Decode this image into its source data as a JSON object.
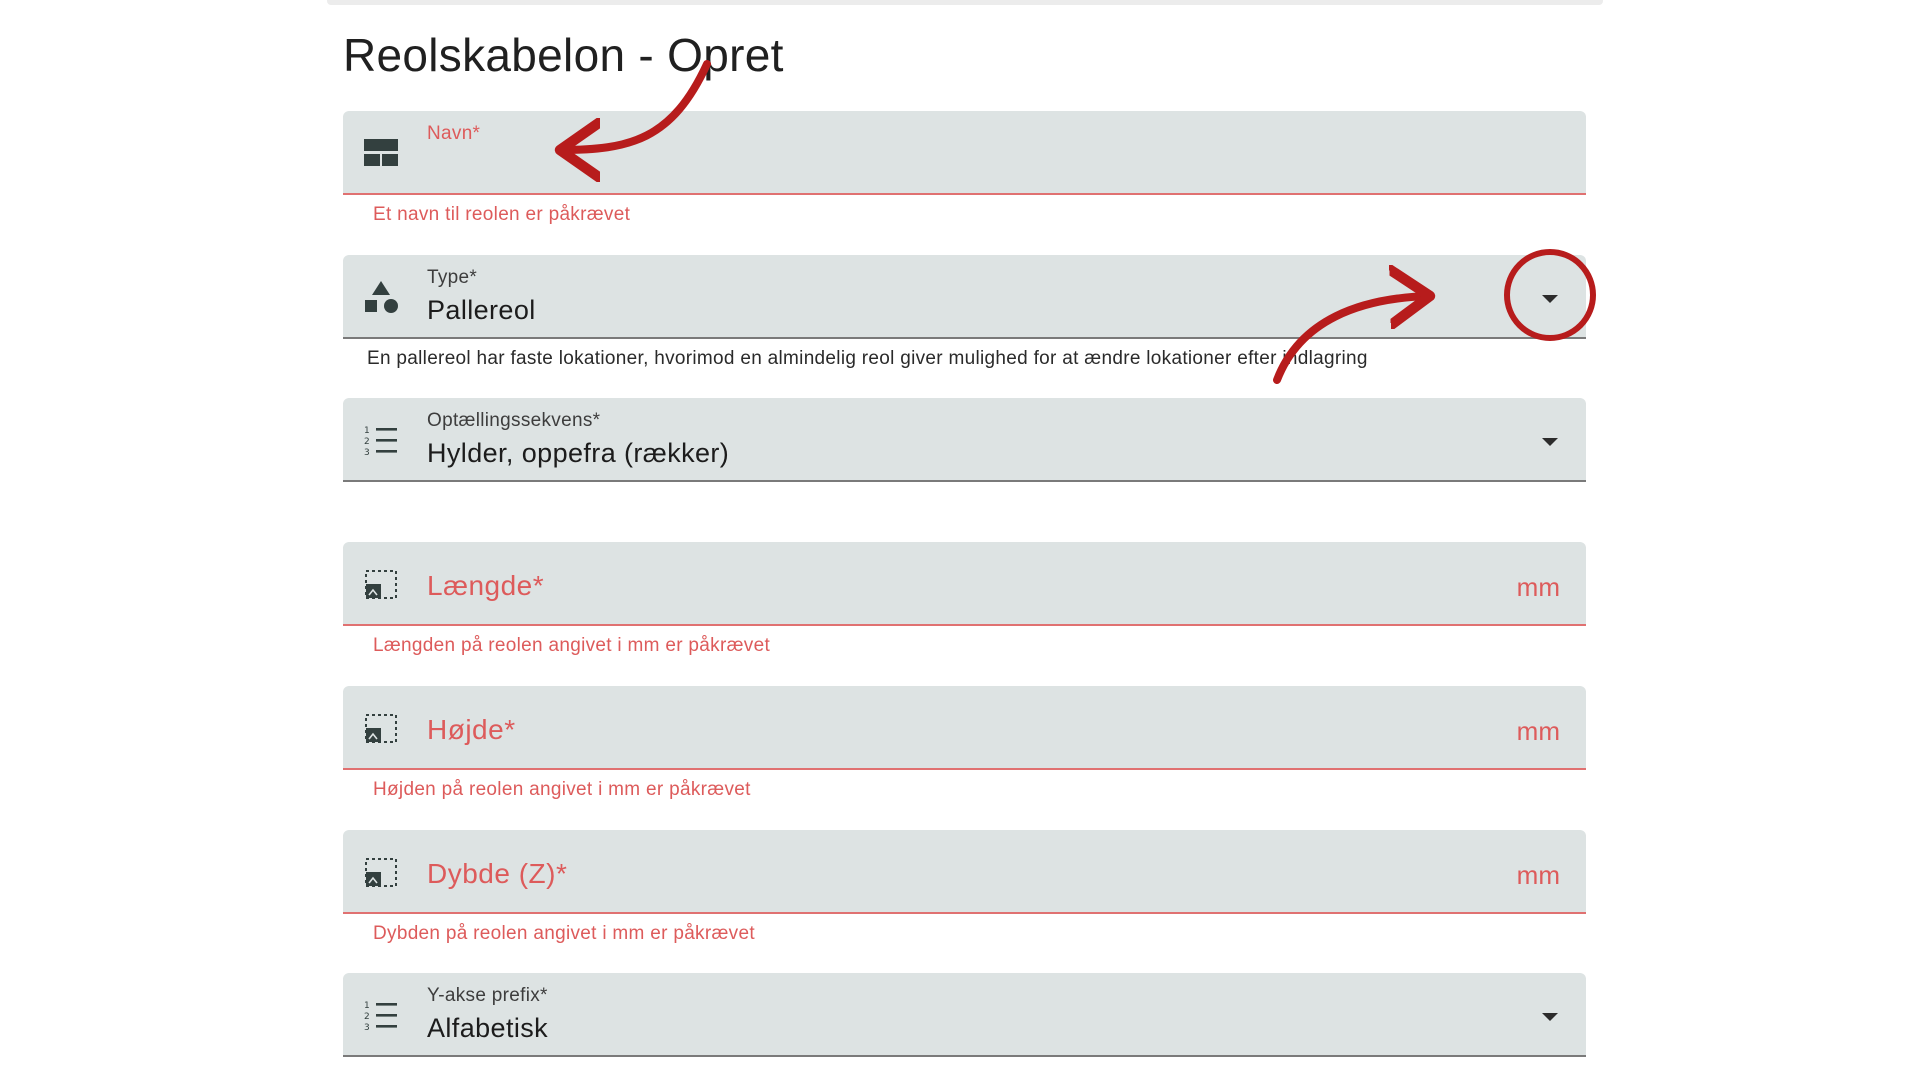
{
  "page": {
    "title": "Reolskabelon - Opret"
  },
  "fields": {
    "name": {
      "label": "Navn*",
      "error": "Et navn til reolen er påkrævet",
      "value": ""
    },
    "type": {
      "label": "Type*",
      "value": "Pallereol",
      "helper": "En pallereol har faste lokationer, hvorimod en almindelig reol giver mulighed for at ændre lokationer efter indlagring"
    },
    "sequence": {
      "label": "Optællingssekvens*",
      "value": "Hylder, oppefra (rækker)"
    },
    "length": {
      "label": "Længde*",
      "suffix": "mm",
      "error": "Længden på reolen angivet i mm er påkrævet"
    },
    "height": {
      "label": "Højde*",
      "suffix": "mm",
      "error": "Højden på reolen angivet i mm er påkrævet"
    },
    "depth": {
      "label": "Dybde (Z)*",
      "suffix": "mm",
      "error": "Dybden på reolen angivet i mm er påkrævet"
    },
    "yprefix": {
      "label": "Y-akse prefix*",
      "value": "Alfabetisk"
    }
  },
  "icons": {
    "name": "view-agenda-icon",
    "type": "shapes-icon",
    "sequence": "numbered-list-icon",
    "dimension": "dimensions-icon",
    "dropdown": "chevron-down-icon"
  },
  "colors": {
    "field_bg": "#dde3e3",
    "error": "#dd5b5b",
    "annotation": "#b71c1c",
    "icon": "#33403f"
  }
}
